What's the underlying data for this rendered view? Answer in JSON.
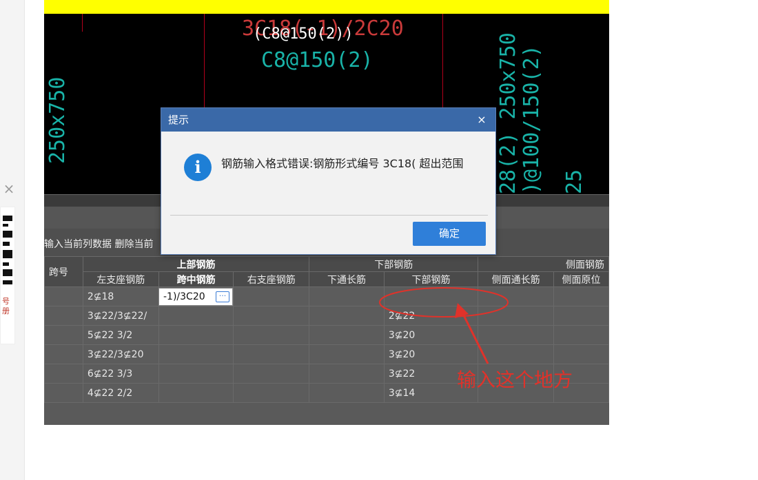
{
  "cad": {
    "top_label_overlap": "3C18(-1)/2C20",
    "top_label": "(C8@150(2))",
    "stirrup_label": "C8@150(2)",
    "left_vertical": "250x750",
    "right_vertical_1": "28(2) 250x750",
    "right_vertical_2": ")@100/150(2)",
    "right_vertical_3": "25"
  },
  "ops": {
    "text": "输入当前列数据  删除当前"
  },
  "table": {
    "span_header": "跨号",
    "groups": {
      "top": "上部钢筋",
      "bottom": "下部钢筋",
      "side": "侧面钢筋"
    },
    "columns": {
      "left_support": "左支座钢筋",
      "mid_span": "跨中钢筋",
      "right_support": "右支座钢筋",
      "bottom_continuous": "下通长筋",
      "bottom_rebar": "下部钢筋",
      "side_continuous": "侧面通长筋",
      "side_original": "侧面原位"
    },
    "rows": [
      {
        "left_support": "2⊈18",
        "bottom_rebar": ""
      },
      {
        "left_support": "3⊈22/3⊈22/",
        "bottom_rebar": "2⊈22"
      },
      {
        "left_support": "5⊈22 3/2",
        "bottom_rebar": "3⊈20"
      },
      {
        "left_support": "3⊈22/3⊈20",
        "bottom_rebar": "3⊈20"
      },
      {
        "left_support": "6⊈22 3/3",
        "bottom_rebar": "3⊈22"
      },
      {
        "left_support": "4⊈22 2/2",
        "bottom_rebar": "3⊈14"
      }
    ]
  },
  "editor": {
    "value": "-1)/3C20",
    "ellipsis": "···"
  },
  "dialog": {
    "title": "提示",
    "close": "×",
    "icon": "i",
    "message": "钢筋输入格式错误:钢筋形式编号 3C18( 超出范围",
    "ok": "确定"
  },
  "annotation": {
    "text": "输入这个地方"
  },
  "rail": {
    "close": "×",
    "side_text": "号册"
  },
  "colors": {
    "cad_bg": "#000000",
    "cad_cyan": "#19b3a8",
    "dialog_title_bg": "#3a69a8",
    "ok_button": "#2f7fd9",
    "annotation_red": "#e0322a",
    "yellow_band": "#ffff00"
  }
}
